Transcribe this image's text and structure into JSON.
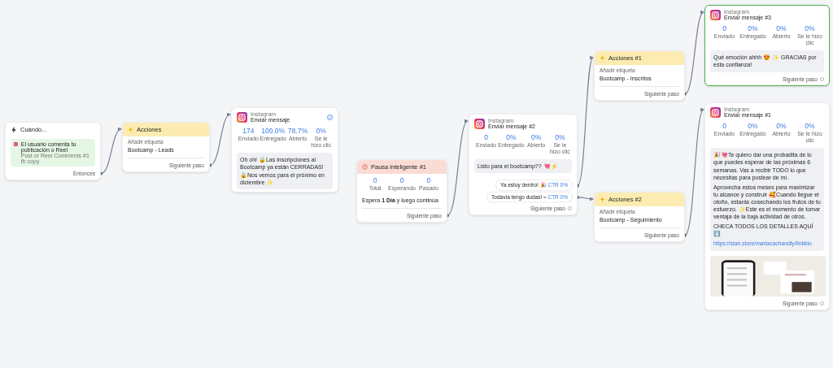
{
  "nodes": [
    {
      "kind": "trigger",
      "title": "Cuándo...",
      "trigger_text": "El usuario comenta tu publicación o Reel",
      "trigger_detail": "Post or Reel Comments #1 fb copy",
      "footer": "Entonces"
    },
    {
      "kind": "action",
      "title": "Acciones",
      "action_label": "Añadir etiqueta",
      "tag": "Bootcamp - Leads",
      "footer": "Siguiente paso"
    },
    {
      "kind": "message",
      "channel": "Instagram",
      "title": "Enviar mensaje",
      "selected": false,
      "active": true,
      "stats": [
        {
          "value": "174",
          "label": "Enviado"
        },
        {
          "value": "100.0%",
          "label": "Entregado"
        },
        {
          "value": "78.7%",
          "label": "Abierto"
        },
        {
          "value": "0%",
          "label": "Se le hizo clic"
        }
      ],
      "text": "Oh oh! 🔒Las inscripciones al Bootcamp ya están CERRADAS! 🔒Nos vemos para el próximo en diciembre ✨"
    },
    {
      "kind": "pause",
      "title": "Pausa inteligente #1",
      "stats": [
        {
          "value": "0",
          "label": "Total"
        },
        {
          "value": "0",
          "label": "Esperando"
        },
        {
          "value": "0",
          "label": "Pasado"
        }
      ],
      "text": "Espera **1 Día** y luego continúa",
      "footer": "Siguiente paso"
    },
    {
      "kind": "message",
      "channel": "Instagram",
      "title": "Enviar mensaje #2",
      "selected": false,
      "active": false,
      "stats": [
        {
          "value": "0",
          "label": "Enviado"
        },
        {
          "value": "0%",
          "label": "Entregado"
        },
        {
          "value": "0%",
          "label": "Abierto"
        },
        {
          "value": "0%",
          "label": "Se le hizo clic"
        }
      ],
      "text": "Listo para el bootcamp?? 💘⚡",
      "buttons": [
        {
          "label": "Ya estoy dentro! 🎉",
          "ctr": "CTR 0%"
        },
        {
          "label": "Todavía tengo dudas! ≈",
          "ctr": "CTR 0%"
        }
      ],
      "footer": "Siguiente paso"
    },
    {
      "kind": "action",
      "title": "Acciones #1",
      "action_label": "Añadir etiqueta",
      "tag": "Bootcamp - Inscritos",
      "footer": "Siguiente paso"
    },
    {
      "kind": "message",
      "channel": "Instagram",
      "title": "Enviar mensaje #3",
      "selected": true,
      "active": false,
      "stats": [
        {
          "value": "0",
          "label": "Enviado"
        },
        {
          "value": "0%",
          "label": "Entregado"
        },
        {
          "value": "0%",
          "label": "Abierto"
        },
        {
          "value": "0%",
          "label": "Se le hizo clic"
        }
      ],
      "text": "Qué emoción ahhh 😍 ✨ GRACIAS por esta confianza!",
      "footer": "Siguiente paso"
    },
    {
      "kind": "action",
      "title": "Acciones #2",
      "action_label": "Añadir etiqueta",
      "tag": "Bootcamp - Seguimiento",
      "footer": "Siguiente paso"
    },
    {
      "kind": "message",
      "channel": "Instagram",
      "title": "Enviar mensaje #1",
      "selected": false,
      "active": false,
      "stats": [
        {
          "value": "0",
          "label": "Enviado"
        },
        {
          "value": "0%",
          "label": "Entregado"
        },
        {
          "value": "0%",
          "label": "Abierto"
        },
        {
          "value": "0%",
          "label": "Se le hizo clic"
        }
      ],
      "paragraphs": [
        "🎉💘Te quiero dar una probadita de lo que puedes esperar de las próximas 6 semanas. Vas a recibir TODO lo que necesitas para postear de mí.",
        "Aprovecha estos meses para maximizar tu alcance y construir 🥰Cuando llegue el otoño, estarás cosechando los frutos de tu esfuerzo. ✨Este es el momento de tomar ventaja de la baja actividad de otros.",
        "CHECA TODOS LOS DETALLES AQUÍ ⬇️"
      ],
      "link": "https://stan.store/mariacachandly/linkbio",
      "media": {
        "kind": "picture"
      },
      "footer": "Siguiente paso"
    }
  ]
}
